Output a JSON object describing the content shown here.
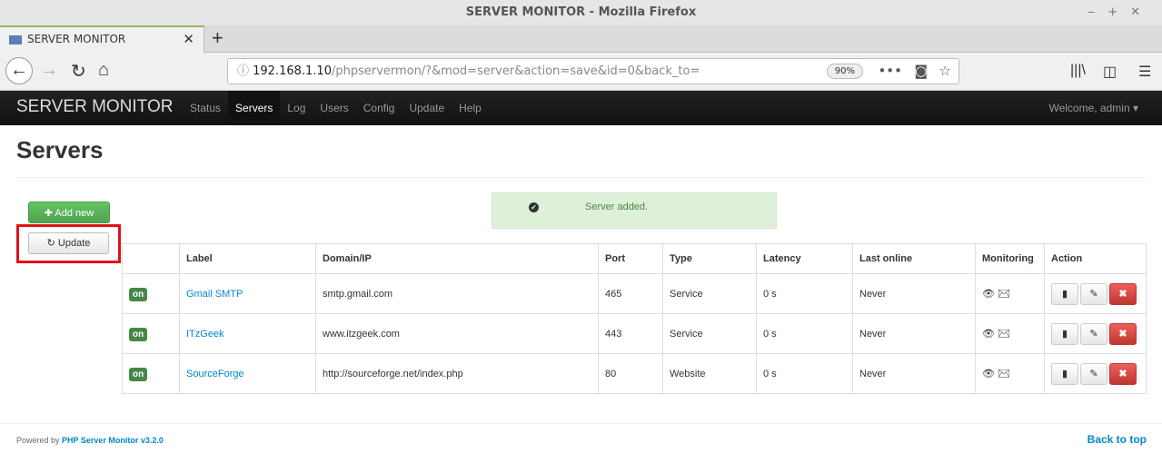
{
  "browser": {
    "window_title": "SERVER MONITOR - Mozilla Firefox",
    "tab_title": "SERVER MONITOR",
    "url_host": "192.168.1.10",
    "url_path": "/phpservermon/?&mod=server&action=save&id=0&back_to=",
    "zoom": "90%"
  },
  "app": {
    "brand": "SERVER MONITOR",
    "menu": [
      {
        "label": "Status"
      },
      {
        "label": "Servers"
      },
      {
        "label": "Log"
      },
      {
        "label": "Users"
      },
      {
        "label": "Config"
      },
      {
        "label": "Update"
      },
      {
        "label": "Help"
      }
    ],
    "welcome": "Welcome, admin"
  },
  "page": {
    "title": "Servers",
    "add_new": "Add new",
    "update": "Update",
    "alert": "Server added."
  },
  "table": {
    "headers": [
      "",
      "Label",
      "Domain/IP",
      "Port",
      "Type",
      "Latency",
      "Last online",
      "Monitoring",
      "Action"
    ],
    "rows": [
      {
        "status": "on",
        "label": "Gmail SMTP",
        "domain": "smtp.gmail.com",
        "port": "465",
        "type": "Service",
        "latency": "0 s",
        "last_online": "Never"
      },
      {
        "status": "on",
        "label": "ITzGeek",
        "domain": "www.itzgeek.com",
        "port": "443",
        "type": "Service",
        "latency": "0 s",
        "last_online": "Never"
      },
      {
        "status": "on",
        "label": "SourceForge",
        "domain": "http://sourceforge.net/index.php",
        "port": "80",
        "type": "Website",
        "latency": "0 s",
        "last_online": "Never"
      }
    ]
  },
  "footer": {
    "powered": "Powered by",
    "link": "PHP Server Monitor v3.2.0",
    "back_to_top": "Back to top"
  }
}
